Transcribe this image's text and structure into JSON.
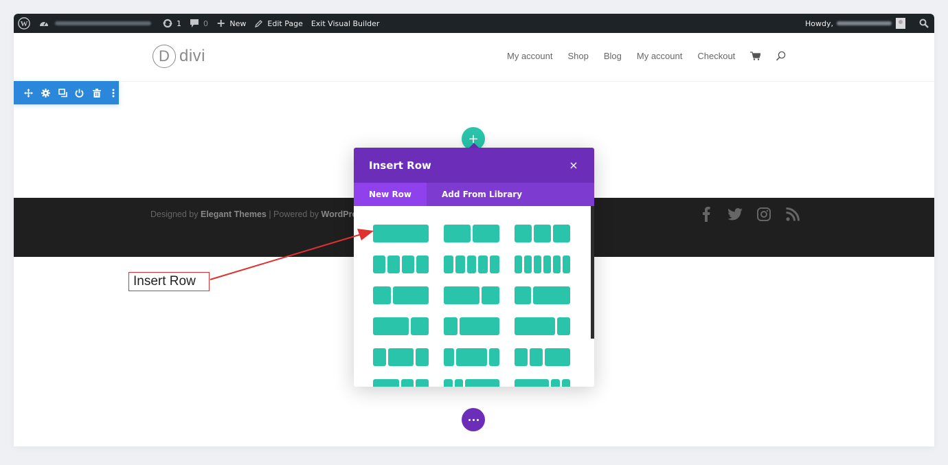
{
  "admin_bar": {
    "wp_logo_icon": "wordpress-icon",
    "site_name_redacted": true,
    "updates_count": "1",
    "comments_count": "0",
    "new_label": "New",
    "edit_page_label": "Edit Page",
    "exit_builder_label": "Exit Visual Builder",
    "howdy_label": "Howdy,"
  },
  "header": {
    "logo_letter": "D",
    "logo_text": "divi",
    "nav": [
      "My account",
      "Shop",
      "Blog",
      "My account",
      "Checkout"
    ]
  },
  "section_toolbar": {
    "icons": [
      "move-icon",
      "settings-icon",
      "duplicate-icon",
      "disable-icon",
      "trash-icon",
      "more-vertical-icon"
    ]
  },
  "add_row_button": {
    "label": "+"
  },
  "footer": {
    "credits_prefix": "Designed by",
    "credits_brand": "Elegant Themes",
    "credits_sep": " | Powered by ",
    "credits_platform": "WordPress",
    "social_icons": [
      "facebook-icon",
      "twitter-icon",
      "instagram-icon",
      "rss-icon"
    ]
  },
  "modal": {
    "title": "Insert Row",
    "close_label": "×",
    "tabs": [
      {
        "label": "New Row",
        "active": true
      },
      {
        "label": "Add From Library",
        "active": false
      }
    ],
    "layouts": [
      [
        1
      ],
      [
        1,
        1
      ],
      [
        1,
        1,
        1
      ],
      [
        1,
        1,
        1,
        1
      ],
      [
        1,
        1,
        1,
        1,
        1
      ],
      [
        1,
        1,
        1,
        1,
        1,
        1
      ],
      [
        1,
        2
      ],
      [
        2,
        1
      ],
      [
        1,
        2.2
      ],
      [
        2,
        1
      ],
      [
        1,
        3
      ],
      [
        3,
        1
      ],
      [
        1,
        2,
        1
      ],
      [
        1,
        3,
        1
      ],
      [
        1,
        1,
        2
      ],
      [
        2,
        1,
        1
      ],
      [
        1,
        1,
        4
      ],
      [
        4,
        1,
        1
      ]
    ],
    "accent_color": "#29c4a9",
    "header_color": "#6c2eb9"
  },
  "more_button": {
    "icon": "ellipsis-icon"
  },
  "annotation": {
    "label": "Insert Row",
    "color": "#e03131"
  }
}
